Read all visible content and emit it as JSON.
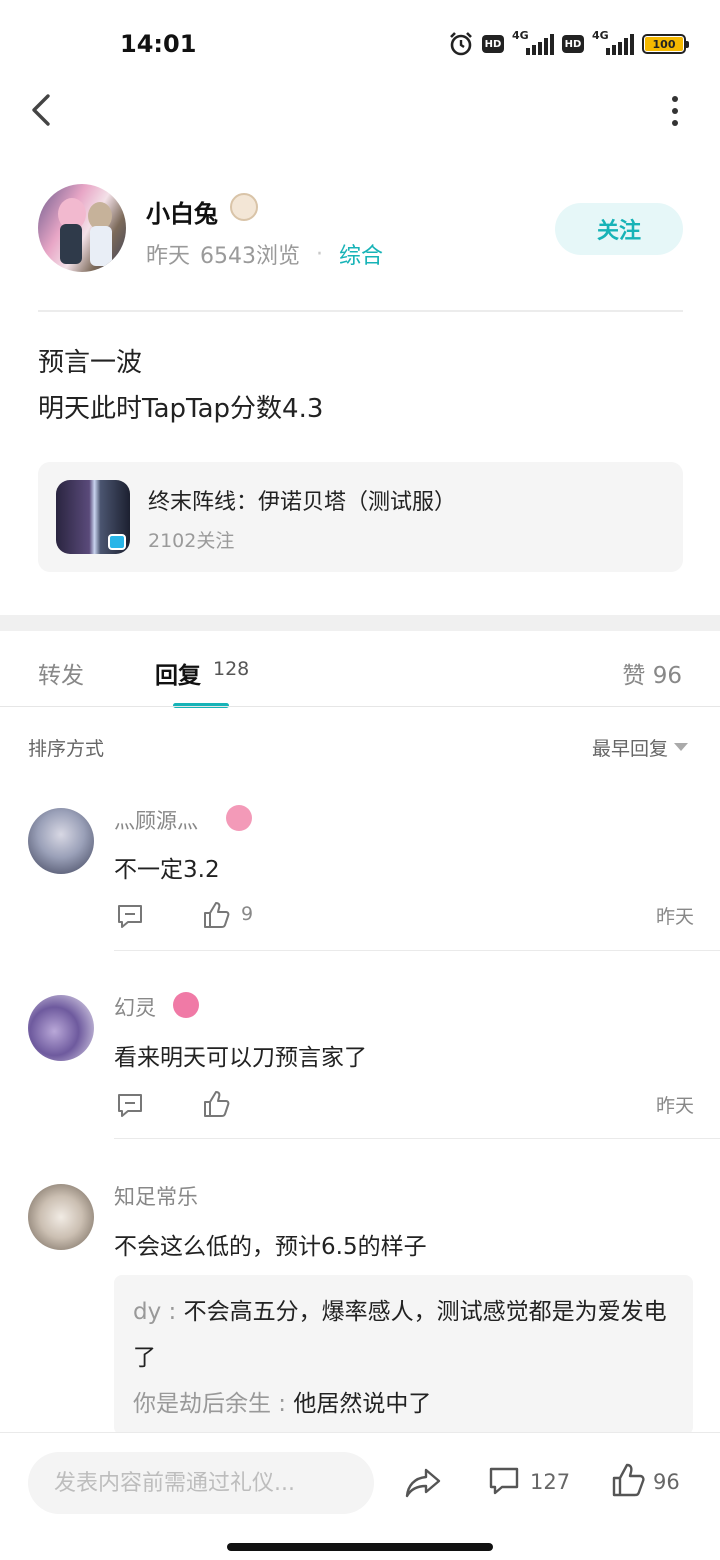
{
  "status_bar": {
    "time": "14:01",
    "battery": "100",
    "network": "4G"
  },
  "author": {
    "name": "小白兔",
    "time": "昨天",
    "views": "6543浏览",
    "category": "综合",
    "follow_label": "关注"
  },
  "post": {
    "lines": [
      "预言一波",
      "明天此时TapTap分数4.3"
    ]
  },
  "game": {
    "title": "终末阵线：伊诺贝塔（测试服）",
    "followers": "2102关注"
  },
  "tabs": {
    "forward": "转发",
    "reply": "回复",
    "reply_count": "128",
    "like": "赞 96"
  },
  "sort": {
    "label": "排序方式",
    "value": "最早回复"
  },
  "comments": [
    {
      "name": "灬顾源灬",
      "text": "不一定3.2",
      "likes": "9",
      "time": "昨天"
    },
    {
      "name": "幻灵",
      "text": "看来明天可以刀预言家了",
      "likes": "",
      "time": "昨天"
    },
    {
      "name": "知足常乐",
      "text": "不会这么低的，预计6.5的样子",
      "replies": [
        {
          "name": "dy",
          "text": "不会高五分，爆率感人，测试感觉都是为爱发电了"
        },
        {
          "name": "你是劫后余生",
          "text": "他居然说中了"
        }
      ]
    }
  ],
  "bottom_bar": {
    "input_placeholder": "发表内容前需通过礼仪...",
    "comment_count": "127",
    "like_count": "96"
  },
  "colors": {
    "accent": "#17b3b7",
    "follow_bg": "#e6f7f8",
    "muted_text": "#9a9a9a"
  }
}
